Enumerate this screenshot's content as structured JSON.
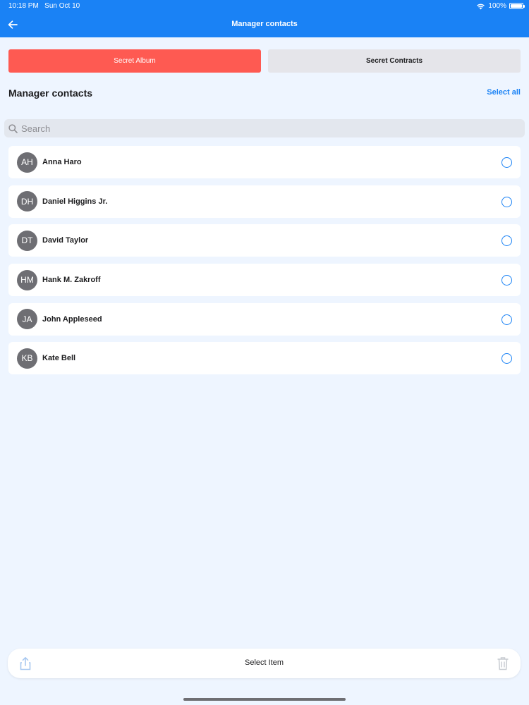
{
  "status_bar": {
    "time": "10:18 PM",
    "date": "Sun Oct 10",
    "battery": "100%"
  },
  "nav": {
    "title": "Manager contacts",
    "back_icon": "arrow-left-icon"
  },
  "segments": {
    "album_label": "Secret Album",
    "contracts_label": "Secret Contracts"
  },
  "section": {
    "title": "Manager contacts",
    "select_all": "Select all"
  },
  "search": {
    "placeholder": "Search",
    "value": ""
  },
  "contacts": [
    {
      "initials": "AH",
      "name": "Anna Haro"
    },
    {
      "initials": "DH",
      "name": "Daniel Higgins Jr."
    },
    {
      "initials": "DT",
      "name": "David Taylor"
    },
    {
      "initials": "HM",
      "name": "Hank M. Zakroff"
    },
    {
      "initials": "JA",
      "name": "John Appleseed"
    },
    {
      "initials": "KB",
      "name": "Kate Bell"
    }
  ],
  "bottom_bar": {
    "label": "Select Item",
    "left_icon": "share-icon",
    "right_icon": "trash-icon"
  },
  "colors": {
    "accent": "#1a82f5",
    "active_segment": "#fe5a52",
    "background": "#eef5ff",
    "avatar": "#6e6e73"
  }
}
